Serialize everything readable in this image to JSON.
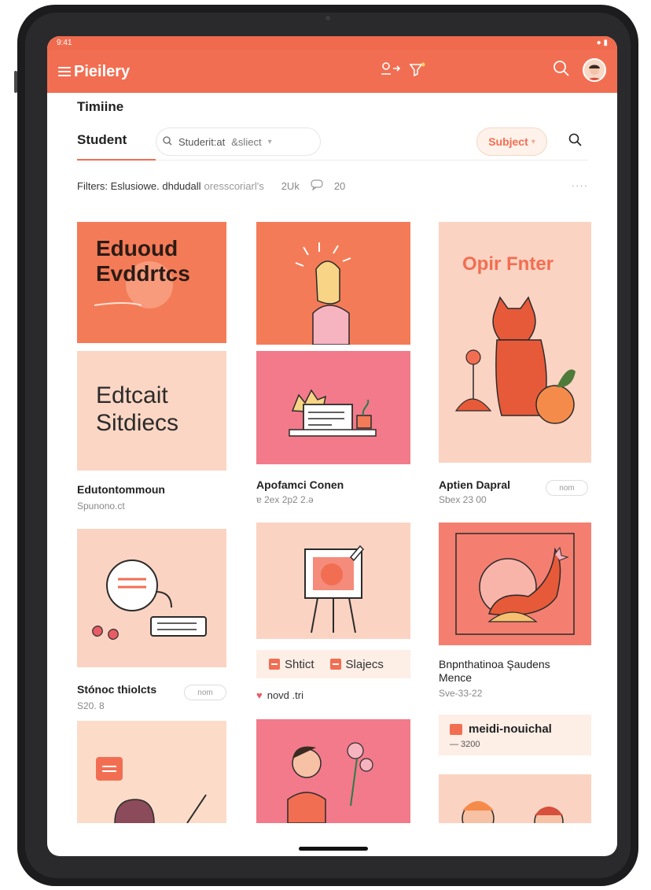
{
  "status": {
    "time": "9:41",
    "indicators": "● ▮"
  },
  "appbar": {
    "title": "Pieilery",
    "menu_icon": "menu-icon",
    "center_icons": [
      "user-arrow-icon",
      "filter-star-icon"
    ],
    "right_icons": [
      "search-icon",
      "avatar"
    ]
  },
  "page": {
    "heading": "Timiine"
  },
  "tabs": {
    "active_label": "Student",
    "search_value": "Studerit:at",
    "subject_select": "&sliect",
    "subject_button": "Subject"
  },
  "filters": {
    "label": "Filters: Eslusiowe. dhdudall",
    "muted": "oresscoriarl's",
    "count1": "2Uk",
    "count2": "20",
    "more": "····"
  },
  "cards": [
    {
      "id": "c1",
      "heading_lines": [
        "Eduoud",
        "Evddrtcs"
      ]
    },
    {
      "id": "c2",
      "heading_lines": [
        "Edtcait",
        "Sitdiecs"
      ],
      "title": "Edutontommoun",
      "meta": "Spunono.ct"
    },
    {
      "id": "c3",
      "title": "Apofamci Conen",
      "meta": "ɐ 2ex 2р2 2.ə"
    },
    {
      "id": "c4",
      "heading": "Opir Fnter",
      "title": "Aptien Dapral",
      "meta": "Sbex 23 00",
      "more": "nom"
    },
    {
      "id": "c5",
      "title": "Stónoc thiolcts",
      "meta": "S20. 8",
      "more": "nom"
    },
    {
      "id": "c6",
      "tags": [
        "Shtict",
        "Slajecs"
      ],
      "footer": "novd .tri"
    },
    {
      "id": "c7",
      "title_lines": [
        "Bnpnthatinoa Şaudens",
        "Mence"
      ],
      "meta": "Sve-33-22"
    },
    {
      "id": "c8",
      "label": "meidi-nouichal",
      "sub": "— 3200"
    }
  ],
  "colors": {
    "accent": "#f26e52",
    "peach": "#f9d3c1",
    "coral": "#f47b57",
    "pink": "#f3737f",
    "salmon": "#f58b7b"
  }
}
